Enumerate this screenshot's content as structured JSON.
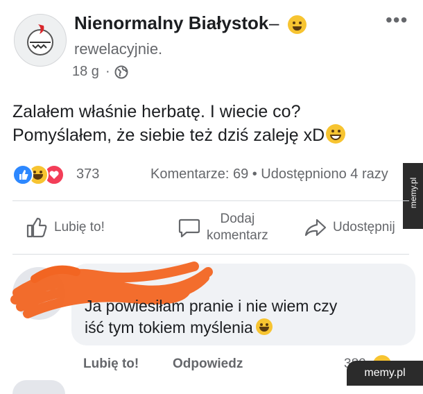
{
  "post": {
    "page_name": "Nienormalny Białystok",
    "separator": "–",
    "feeling": "rewelacyjnie.",
    "time": "18 g",
    "dot": "·",
    "more": "•••",
    "text_line1": "Zalałem właśnie herbatę. I wiecie co?",
    "text_line2": "Pomyślałem, że siebie też dziś zaleję xD"
  },
  "stats": {
    "reactions_count": "373",
    "comments_shares": "Komentarze: 69 • Udostępniono 4 razy"
  },
  "actions": {
    "like": "Lubię to!",
    "comment_line1": "Dodaj",
    "comment_line2": "komentarz",
    "share": "Udostępnij"
  },
  "comment": {
    "text_line1": "Ja powiesiłam pranie i nie wiem czy",
    "text_line2": "iść tym tokiem myślenia",
    "like": "Lubię to!",
    "reply": "Odpowiedz",
    "reactions_count": "382"
  },
  "watermark": {
    "side": "memy.pl",
    "bottom": "memy.pl"
  },
  "icons": {
    "globe": "globe-icon",
    "like": "thumbs-up-icon",
    "comment": "comment-bubble-icon",
    "share": "share-arrow-icon"
  },
  "colors": {
    "secondary_text": "#65676b",
    "like_blue": "#2d88ff",
    "love_red": "#f33e58",
    "haha_yellow": "#f7c431",
    "redaction_orange": "#f26522"
  }
}
